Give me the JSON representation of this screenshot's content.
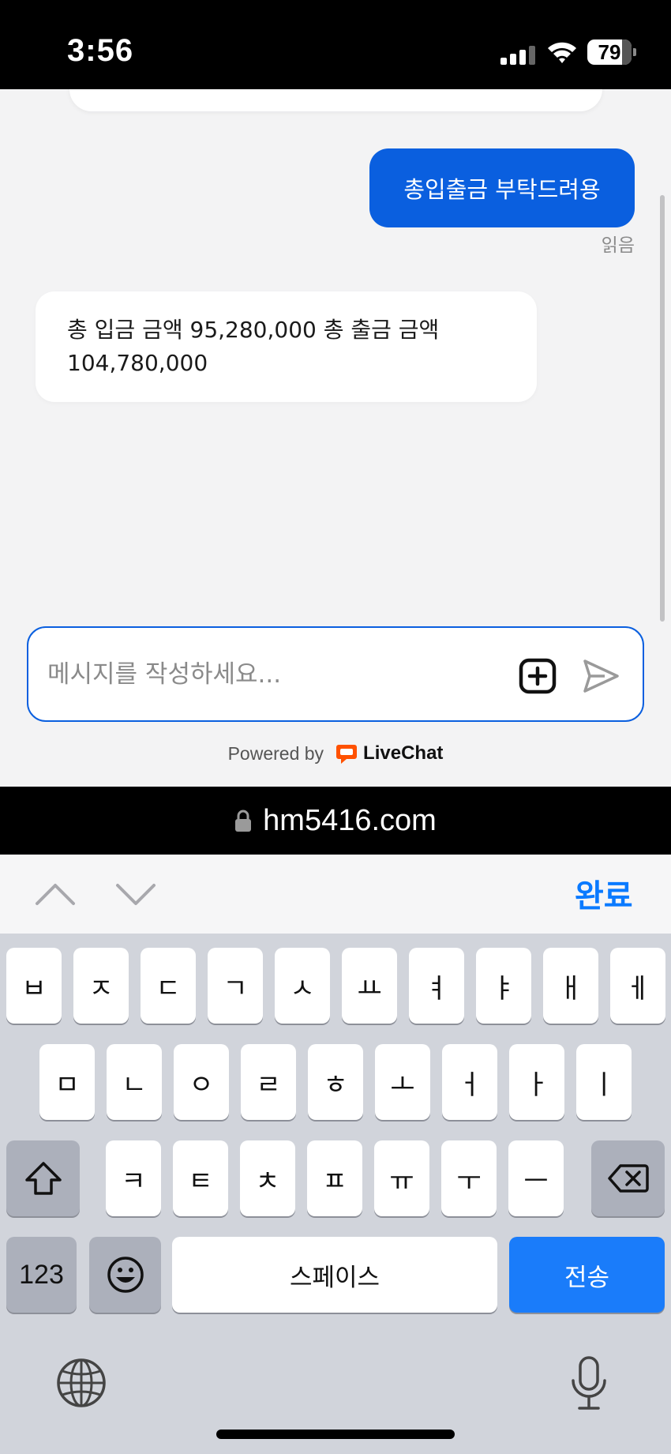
{
  "status_bar": {
    "time": "3:56",
    "battery": "79",
    "battery_level_percent": 79
  },
  "chat": {
    "outgoing_message": "총입출금 부탁드려용",
    "read_receipt": "읽음",
    "incoming_message": "총 입금 금액 95,280,000 총 출금 금액 104,780,000"
  },
  "composer": {
    "placeholder": "메시지를 작성하세요..."
  },
  "footer": {
    "powered_by": "Powered by",
    "brand": "LiveChat",
    "brand_color": "#ff5100"
  },
  "browser": {
    "url": "hm5416.com"
  },
  "accessory": {
    "done_label": "완료"
  },
  "keyboard": {
    "row1": [
      "ㅂ",
      "ㅈ",
      "ㄷ",
      "ㄱ",
      "ㅅ",
      "ㅛ",
      "ㅕ",
      "ㅑ",
      "ㅐ",
      "ㅔ"
    ],
    "row2": [
      "ㅁ",
      "ㄴ",
      "ㅇ",
      "ㄹ",
      "ㅎ",
      "ㅗ",
      "ㅓ",
      "ㅏ",
      "ㅣ"
    ],
    "row3": [
      "ㅋ",
      "ㅌ",
      "ㅊ",
      "ㅍ",
      "ㅠ",
      "ㅜ",
      "ㅡ"
    ],
    "numbers_label": "123",
    "space_label": "스페이스",
    "send_label": "전송"
  },
  "colors": {
    "accent": "#0a5fdf",
    "keyboard_blue": "#1a7cfa",
    "done_blue": "#0a7aff"
  }
}
